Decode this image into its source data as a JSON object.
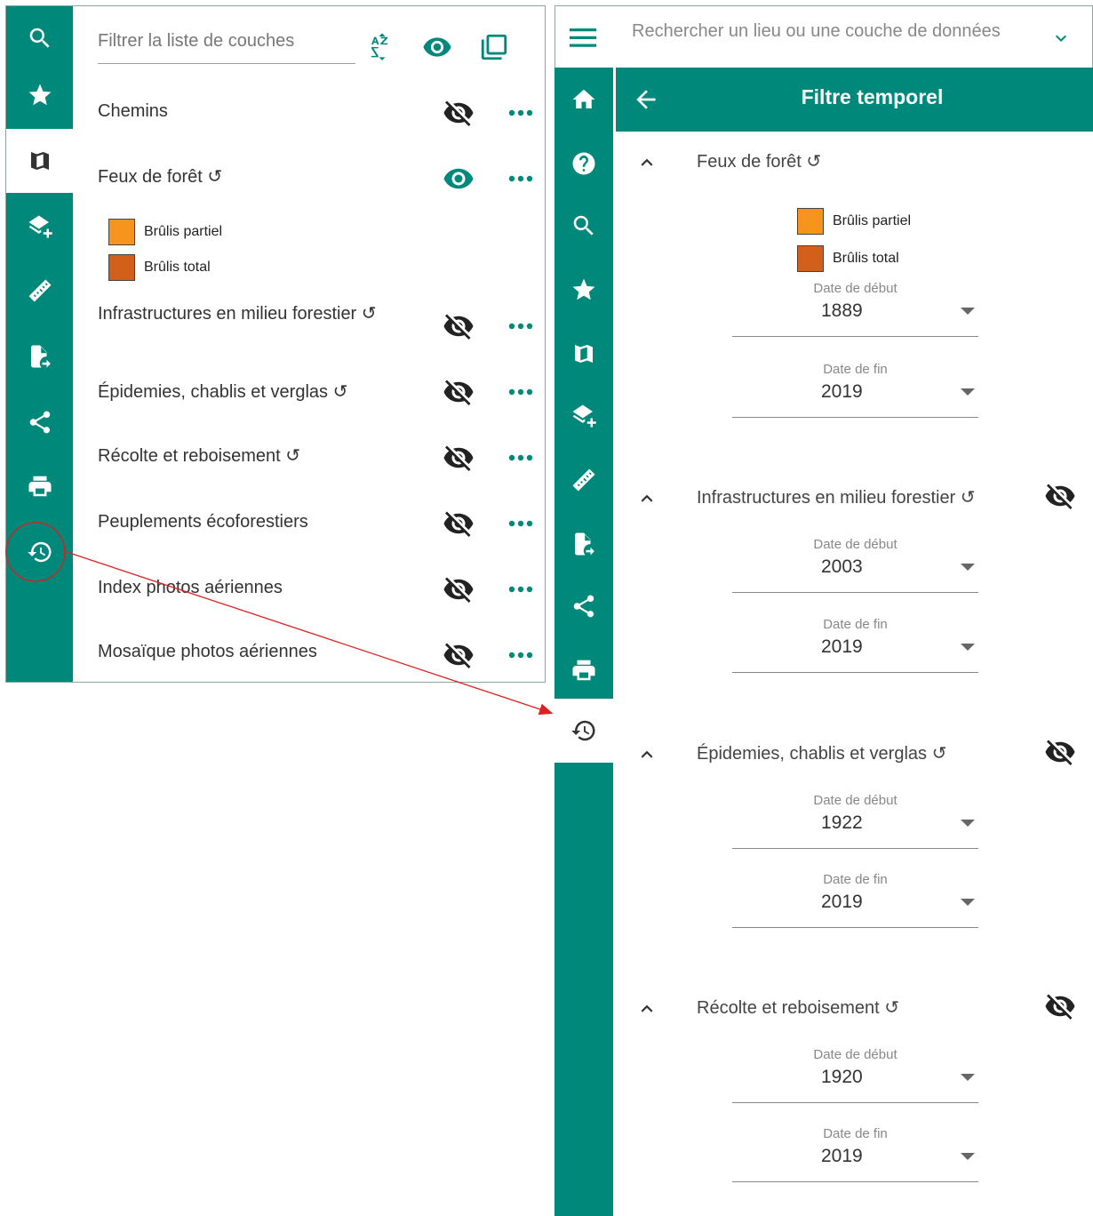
{
  "left_panel": {
    "filter_placeholder": "Filtrer la liste de couches",
    "sort_icon": "sort-az-icon",
    "layers": [
      {
        "name": "Chemins",
        "visible": false
      },
      {
        "name": "Feux de forêt ↺",
        "visible": true,
        "legend": [
          {
            "label": "Brûlis partiel",
            "color": "#f7941d"
          },
          {
            "label": "Brûlis total",
            "color": "#d2601a"
          }
        ]
      },
      {
        "name": "Infrastructures en milieu forestier ↺",
        "visible": false
      },
      {
        "name": "Épidemies, chablis et verglas ↺",
        "visible": false
      },
      {
        "name": "Récolte et reboisement ↺",
        "visible": false
      },
      {
        "name": "Peuplements écoforestiers",
        "visible": false
      },
      {
        "name": "Index photos aériennes",
        "visible": false
      },
      {
        "name": "Mosaïque photos aériennes",
        "visible": false
      }
    ]
  },
  "right_panel": {
    "search_placeholder": "Rechercher un lieu ou une couche de données",
    "header_title": "Filtre temporel",
    "sections": [
      {
        "name": "Feux de forêt ↺",
        "start_label": "Date de début",
        "start": "1889",
        "end_label": "Date de fin",
        "end": "2019",
        "legend": [
          {
            "label": "Brûlis partiel",
            "color": "#f7941d"
          },
          {
            "label": "Brûlis total",
            "color": "#d2601a"
          }
        ]
      },
      {
        "name": "Infrastructures en milieu forestier ↺",
        "start_label": "Date de début",
        "start": "2003",
        "end_label": "Date de fin",
        "end": "2019"
      },
      {
        "name": "Épidemies, chablis et verglas ↺",
        "start_label": "Date de début",
        "start": "1922",
        "end_label": "Date de fin",
        "end": "2019"
      },
      {
        "name": "Récolte et reboisement ↺",
        "start_label": "Date de début",
        "start": "1920",
        "end_label": "Date de fin",
        "end": "2019"
      }
    ]
  },
  "colors": {
    "accent": "#00897b",
    "annotation": "#e02020"
  }
}
